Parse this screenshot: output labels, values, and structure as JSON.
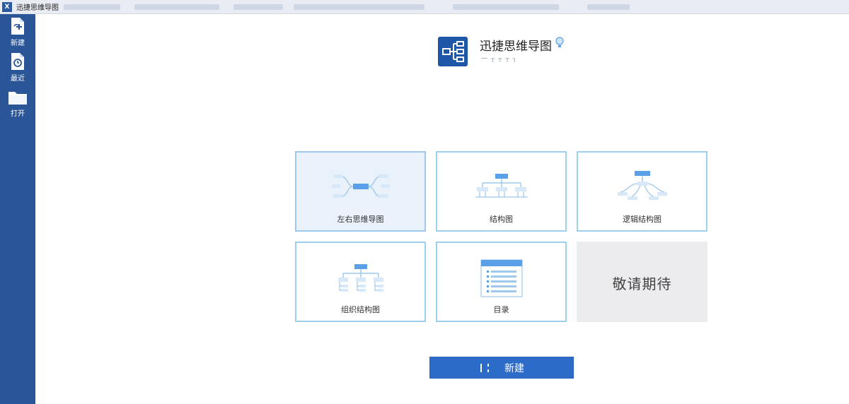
{
  "window": {
    "title": "迅捷思维导图"
  },
  "sidebar": {
    "items": [
      {
        "label": "新建",
        "icon": "new-file-icon"
      },
      {
        "label": "最近",
        "icon": "recent-file-icon"
      },
      {
        "label": "打开",
        "icon": "folder-icon"
      }
    ]
  },
  "app": {
    "name": "迅捷思维导图",
    "subtitle": "一 ┬ ┬ ┬ ┐"
  },
  "templates": [
    {
      "label": "左右思维导图",
      "icon": "mindmap-icon"
    },
    {
      "label": "结构图",
      "icon": "org-structure-icon"
    },
    {
      "label": "逻辑结构图",
      "icon": "logic-structure-icon"
    },
    {
      "label": "组织结构图",
      "icon": "org-chart-icon"
    },
    {
      "label": "目录",
      "icon": "catalog-icon"
    },
    {
      "label": "敬请期待",
      "icon": ""
    }
  ],
  "create_button": {
    "label": "新建"
  },
  "colors": {
    "sidebar": "#2a5596",
    "accent": "#2d6bc9",
    "card_border": "#9ed0ee",
    "selected_card": "#e9f1fb",
    "preview_blue": "#5aa0e8"
  }
}
